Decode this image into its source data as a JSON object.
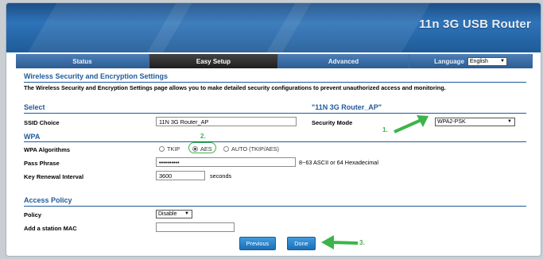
{
  "header": {
    "brand": "11n 3G USB Router"
  },
  "nav": {
    "tabs": [
      {
        "label": "Status",
        "active": false
      },
      {
        "label": "Easy Setup",
        "active": true
      },
      {
        "label": "Advanced",
        "active": false
      }
    ],
    "language_label": "Language",
    "language_value": "English"
  },
  "page": {
    "title": "Wireless Security and Encryption Settings",
    "description": "The Wireless Security and Encryption Settings page allows you to make detailed security configurations to prevent unauthorized access and monitoring."
  },
  "select_section": {
    "title": "Select",
    "ssid_display": "\"11N 3G Router_AP\"",
    "ssid_label": "SSID Choice",
    "ssid_value": "11N 3G Router_AP",
    "security_mode_label": "Security Mode",
    "security_mode_value": "WPA2-PSK"
  },
  "wpa_section": {
    "title": "WPA",
    "algorithms_label": "WPA Algorithms",
    "options": [
      "TKIP",
      "AES",
      "AUTO (TKIP/AES)"
    ],
    "selected": "AES",
    "pass_phrase_label": "Pass Phrase",
    "pass_phrase_value": "••••••••••",
    "pass_phrase_hint": "8~63 ASCII or 64 Hexadecimal",
    "key_renewal_label": "Key Renewal Interval",
    "key_renewal_value": "3600",
    "key_renewal_unit": "seconds"
  },
  "access_policy": {
    "title": "Access Policy",
    "policy_label": "Policy",
    "policy_value": "Disable",
    "add_mac_label": "Add a station MAC",
    "add_mac_value": ""
  },
  "buttons": {
    "previous": "Previous",
    "done": "Done"
  },
  "annotations": {
    "step1": "1.",
    "step2": "2.",
    "step3": "3."
  },
  "colors": {
    "accent": "#1f5a9a",
    "annotation": "#3cb44a",
    "header": "#2e73b8",
    "active_tab": "#1e1e1e"
  }
}
